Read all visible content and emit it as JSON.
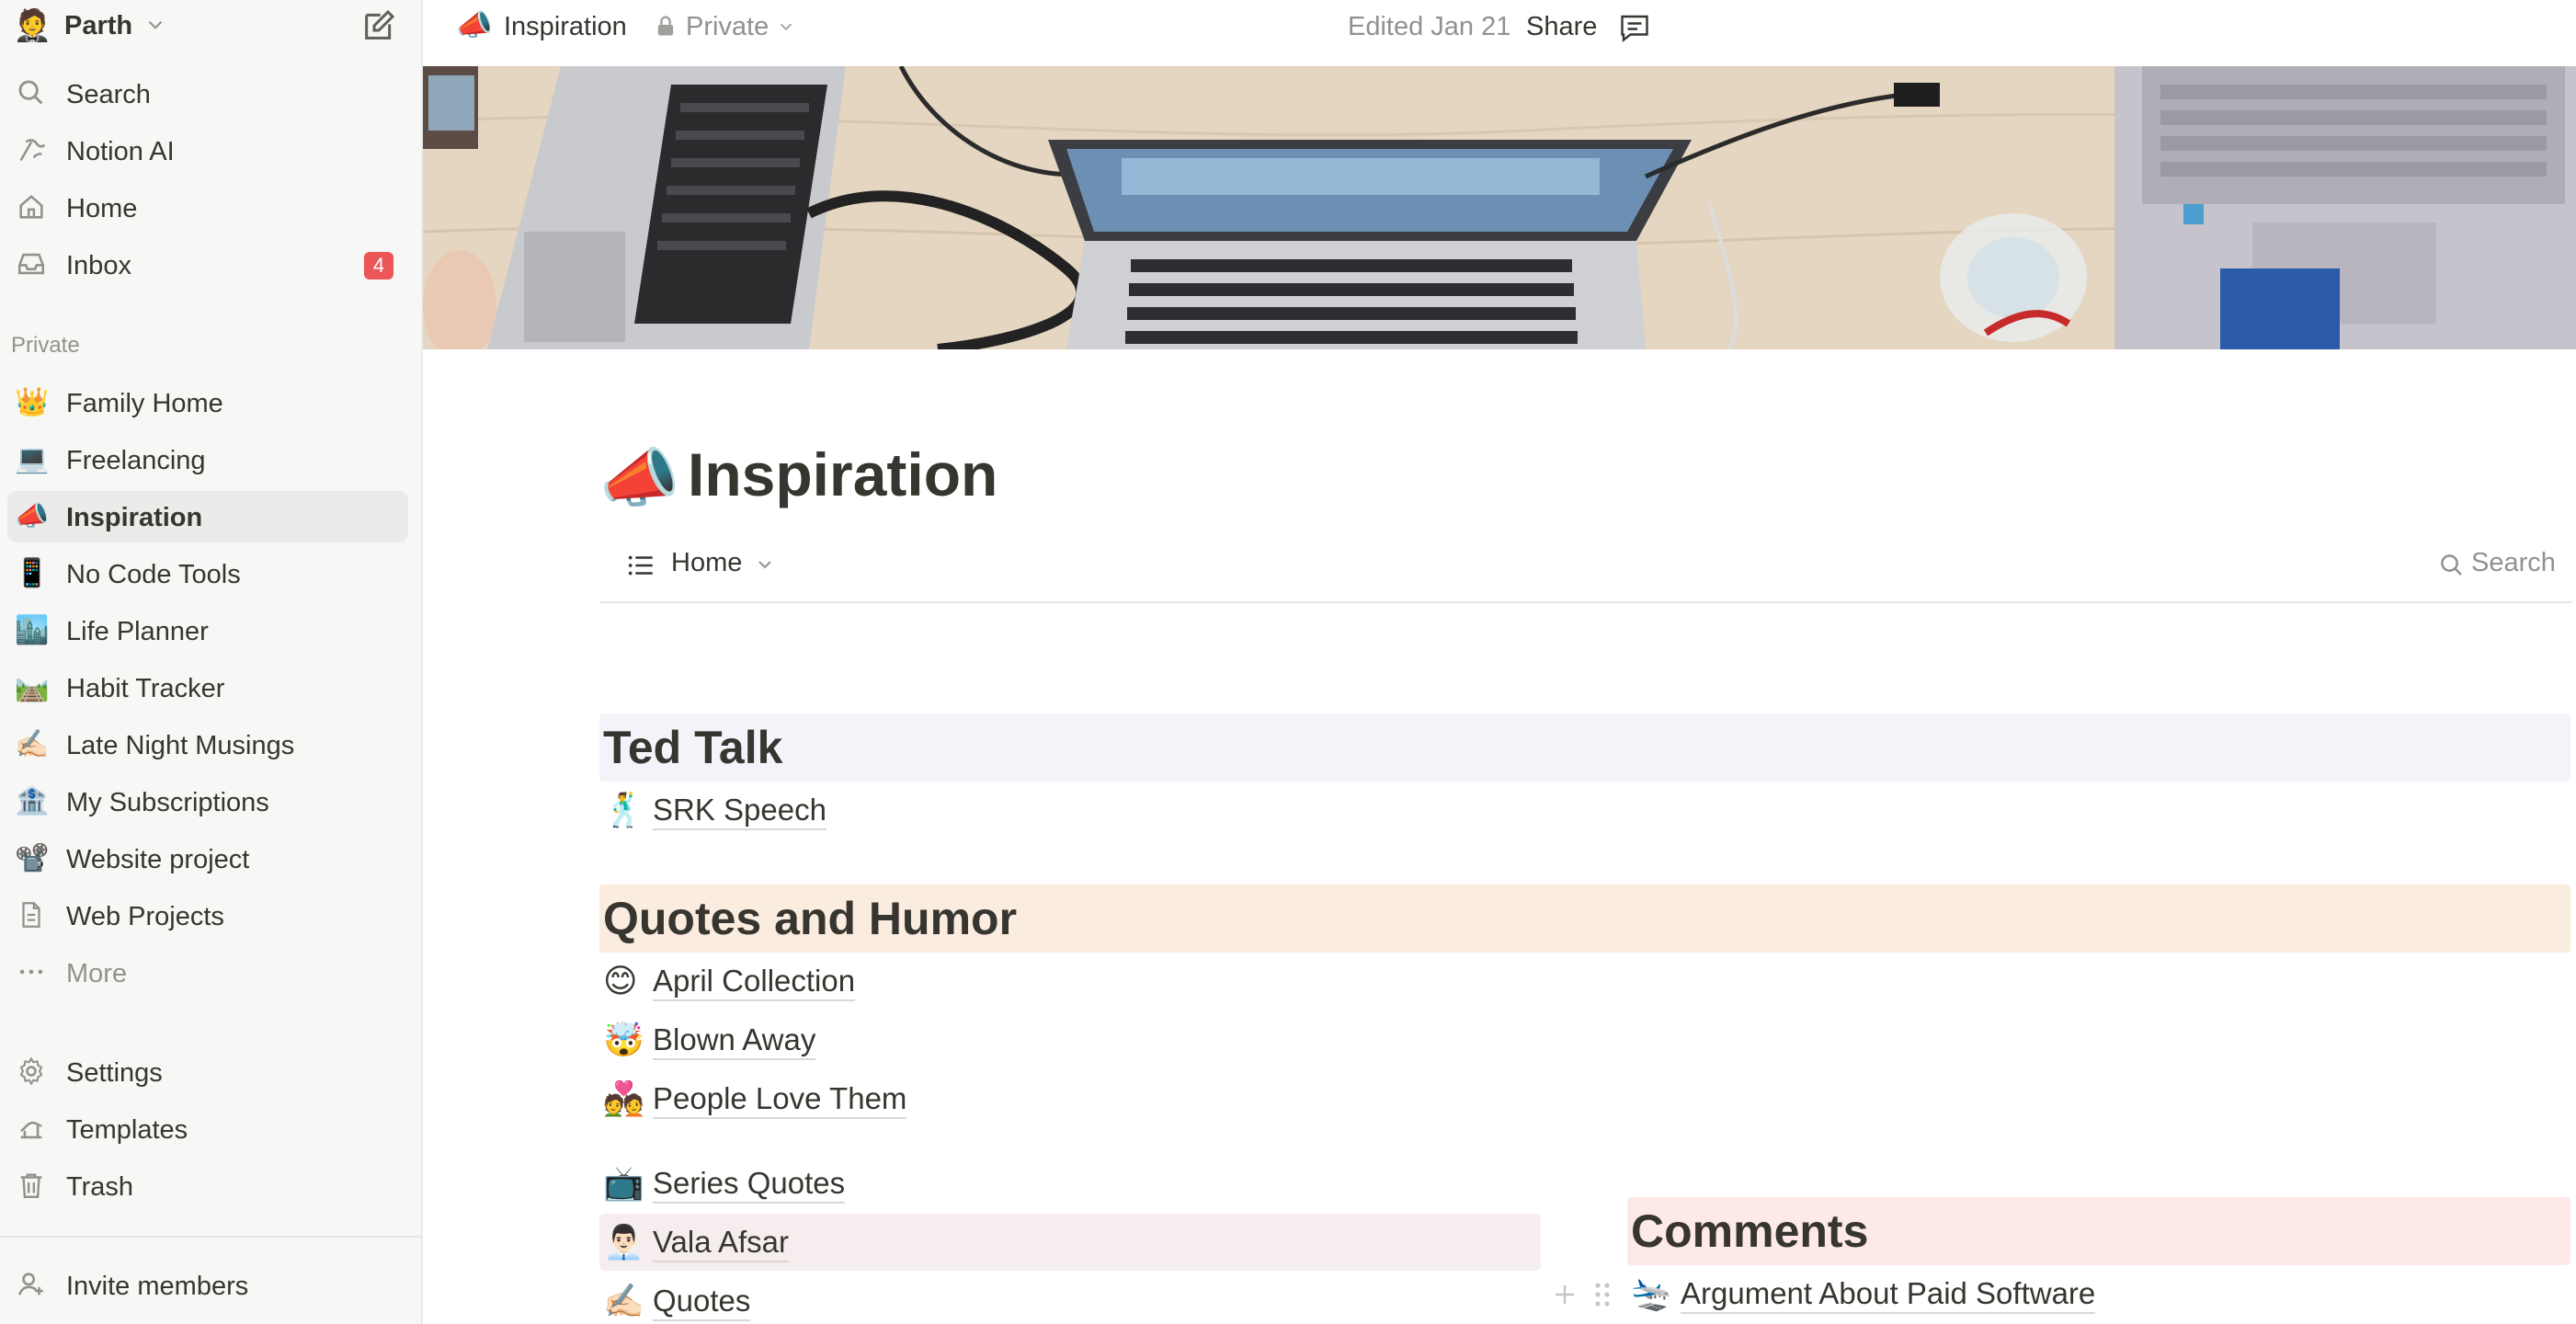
{
  "workspace": {
    "name": "Parth",
    "avatar": "🤵"
  },
  "sidebar": {
    "nav": [
      {
        "label": "Search",
        "icon": "search-icon"
      },
      {
        "label": "Notion AI",
        "icon": "notion-ai-icon"
      },
      {
        "label": "Home",
        "icon": "home-icon"
      },
      {
        "label": "Inbox",
        "icon": "inbox-icon",
        "badge": "4"
      }
    ],
    "section_label": "Private",
    "pages": [
      {
        "emoji": "👑",
        "label": "Family Home"
      },
      {
        "emoji": "💻",
        "label": "Freelancing"
      },
      {
        "emoji": "📣",
        "label": "Inspiration",
        "active": true
      },
      {
        "emoji": "📱",
        "label": "No Code Tools"
      },
      {
        "emoji": "🏙️",
        "label": "Life Planner"
      },
      {
        "emoji": "🛤️",
        "label": "Habit Tracker"
      },
      {
        "emoji": "✍🏻",
        "label": "Late Night Musings"
      },
      {
        "emoji": "🏦",
        "label": "My Subscriptions"
      },
      {
        "emoji": "📽️",
        "label": "Website project"
      },
      {
        "emoji": "",
        "label": "Web Projects",
        "icon": "document-icon"
      }
    ],
    "more_label": "More",
    "footer": [
      {
        "label": "Settings",
        "icon": "gear-icon"
      },
      {
        "label": "Templates",
        "icon": "templates-icon"
      },
      {
        "label": "Trash",
        "icon": "trash-icon"
      }
    ],
    "invite_label": "Invite members"
  },
  "topbar": {
    "emoji": "📣",
    "title": "Inspiration",
    "visibility": "Private",
    "edited": "Edited Jan 21",
    "share_label": "Share"
  },
  "page": {
    "emoji": "📣",
    "title": "Inspiration",
    "view_label": "Home",
    "search_label": "Search"
  },
  "groups": [
    {
      "title": "Ted Talk",
      "color": "#f4f3f9",
      "items": [
        {
          "emoji": "🕺",
          "label": "SRK Speech"
        }
      ]
    },
    {
      "title": "Quotes and Humor",
      "color": "#fbece0",
      "items": [
        {
          "emoji": "😊",
          "label": "April Collection"
        },
        {
          "emoji": "🤯",
          "label": "Blown Away"
        },
        {
          "emoji": "💑",
          "label": "People Love Them"
        },
        {
          "emoji": "📺",
          "label": "Series Quotes"
        },
        {
          "emoji": "👨🏻‍💼",
          "label": "Vala Afsar"
        },
        {
          "emoji": "✍🏻",
          "label": "Quotes"
        }
      ]
    },
    {
      "title": "Comments",
      "color": "#fde9e8",
      "items": [
        {
          "emoji": "🛬",
          "label": "Argument About Paid Software"
        }
      ]
    }
  ],
  "colors": {
    "accent_badge": "#eb5757",
    "sidebar_bg": "#f7f7f5",
    "muted_text": "#91918e"
  }
}
